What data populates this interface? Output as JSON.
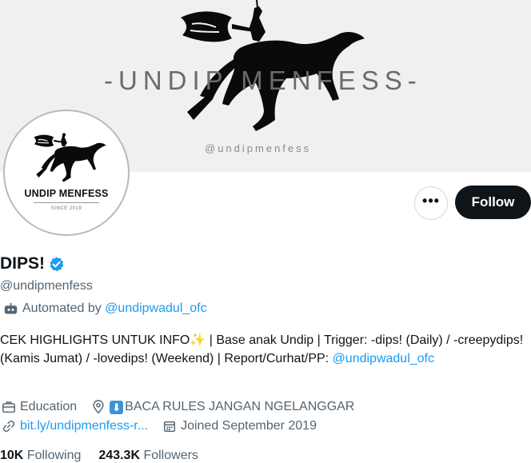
{
  "banner": {
    "title": "-UNDIP MENFESS-",
    "handle": "@undipmenfess"
  },
  "avatar": {
    "name": "UNDIP MENFESS",
    "since": "SINCE 2019"
  },
  "actions": {
    "more_label": "•••",
    "follow_label": "Follow"
  },
  "profile": {
    "display_name": "DIPS!",
    "handle": "@undipmenfess",
    "automated_prefix": "Automated by",
    "automated_link": "@undipwadul_ofc",
    "bio_text": "CEK HIGHLIGHTS UNTUK INFO✨ | Base anak Undip | Trigger: -dips! (Daily) / -creepydips! (Kamis Jumat) / -lovedips! (Weekend) | Report/Curhat/PP: ",
    "bio_link": "@undipwadul_ofc",
    "category": "Education",
    "location_arrow": "⬇",
    "location": "BACA RULES JANGAN NGELANGGAR",
    "website": "bit.ly/undipmenfess-r...",
    "joined": "Joined September 2019"
  },
  "stats": {
    "following_count": "10K",
    "following_label": "Following",
    "followers_count": "243.3K",
    "followers_label": "Followers"
  },
  "colors": {
    "accent": "#1d9bf0",
    "text_primary": "#0f1419",
    "text_secondary": "#536471",
    "follow_bg": "#0f1419"
  },
  "icons": [
    "verified-badge-icon",
    "robot-icon",
    "briefcase-icon",
    "location-pin-icon",
    "link-icon",
    "calendar-icon",
    "more-icon"
  ]
}
